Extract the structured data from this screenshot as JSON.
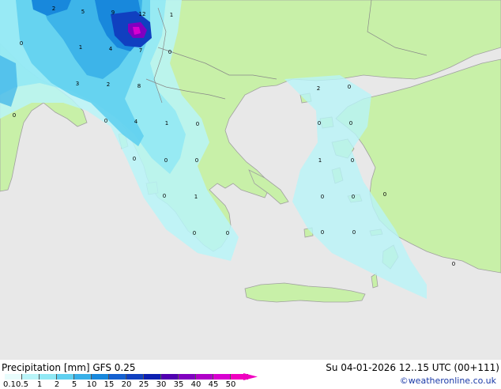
{
  "map": {
    "sea_color": "#e8e8e8",
    "land_color": "#c8f0a8",
    "precip_labels": [
      {
        "t": "2"
      },
      {
        "t": "5"
      },
      {
        "t": "9"
      },
      {
        "t": "12"
      },
      {
        "t": "1"
      },
      {
        "t": "1"
      },
      {
        "t": "4"
      },
      {
        "t": "7"
      },
      {
        "t": "0"
      },
      {
        "t": "0"
      },
      {
        "t": "3"
      },
      {
        "t": "2"
      },
      {
        "t": "8"
      },
      {
        "t": "0"
      },
      {
        "t": "4"
      },
      {
        "t": "1"
      },
      {
        "t": "0"
      },
      {
        "t": "0"
      },
      {
        "t": "2"
      },
      {
        "t": "0"
      },
      {
        "t": "0"
      },
      {
        "t": "0"
      },
      {
        "t": "0"
      },
      {
        "t": "0"
      },
      {
        "t": "0"
      },
      {
        "t": "1"
      },
      {
        "t": "0"
      },
      {
        "t": "0"
      },
      {
        "t": "1"
      },
      {
        "t": "0"
      },
      {
        "t": "0"
      },
      {
        "t": "0"
      },
      {
        "t": "0"
      },
      {
        "t": "0"
      },
      {
        "t": "0"
      },
      {
        "t": "0"
      },
      {
        "t": "0"
      }
    ]
  },
  "footer": {
    "title": "Precipitation [mm]  GFS 0.25",
    "datetime": "Su 04-01-2026 12..15 UTC (00+111)",
    "credit": "©weatheronline.co.uk",
    "scale_ticks": [
      "0.1",
      "0.5",
      "1",
      "2",
      "5",
      "10",
      "15",
      "20",
      "25",
      "30",
      "35",
      "40",
      "45",
      "50"
    ],
    "scale_colors": [
      "#e8fcfc",
      "#b8f4f8",
      "#90e8f4",
      "#60d0f0",
      "#38b0e8",
      "#1888dc",
      "#1460d0",
      "#1040c0",
      "#0c20b0",
      "#5000b0",
      "#8000c0",
      "#b000c8",
      "#d800d0",
      "#f000c0"
    ]
  }
}
